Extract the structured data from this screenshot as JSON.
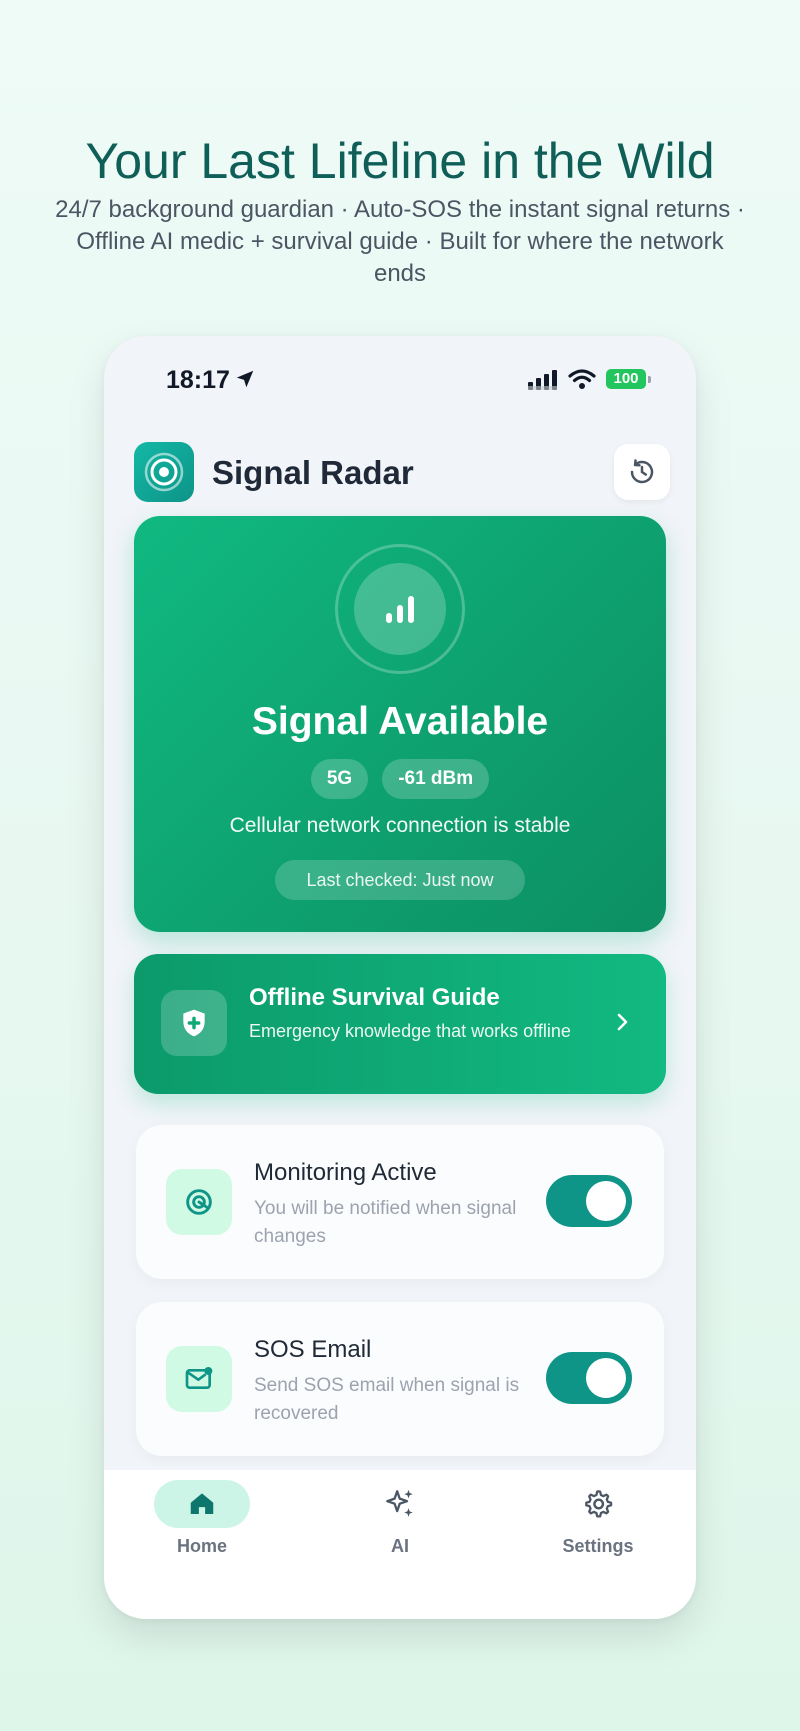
{
  "hero": {
    "title": "Your Last Lifeline in the Wild",
    "subtitle": "24/7 background guardian · Auto-SOS the instant signal returns · Offline AI medic + survival guide · Built for where the network ends"
  },
  "status_bar": {
    "time": "18:17",
    "battery": "100",
    "icons": [
      "location-arrow-icon",
      "cellular-signal-icon",
      "wifi-icon",
      "battery-icon"
    ]
  },
  "header": {
    "app_title": "Signal Radar",
    "logo_icon": "radar-icon",
    "history_icon": "history-icon"
  },
  "signal_card": {
    "status": "Signal Available",
    "network_type": "5G",
    "strength": "-61 dBm",
    "description": "Cellular network connection is stable",
    "last_checked": "Last checked: Just now",
    "icon": "signal-bars-icon"
  },
  "guide": {
    "title": "Offline Survival Guide",
    "subtitle": "Emergency knowledge that works offline",
    "icon": "shield-plus-icon"
  },
  "settings": [
    {
      "title": "Monitoring Active",
      "description": "You will be notified when signal changes",
      "icon": "target-icon",
      "enabled": true
    },
    {
      "title": "SOS Email",
      "description": "Send SOS email when signal is recovered",
      "icon": "mail-icon",
      "enabled": true
    }
  ],
  "tabs": [
    {
      "label": "Home",
      "icon": "home-icon",
      "active": true
    },
    {
      "label": "AI",
      "icon": "sparkles-icon",
      "active": false
    },
    {
      "label": "Settings",
      "icon": "gear-icon",
      "active": false
    }
  ],
  "colors": {
    "accent": "#10b981",
    "accent_dark": "#0f9488",
    "title_color": "#0f5f58",
    "icon_bg": "#d1fae5"
  }
}
